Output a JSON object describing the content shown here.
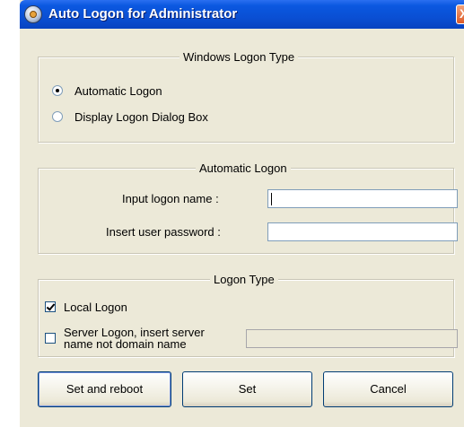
{
  "window": {
    "title": "Auto Logon for Administrator",
    "close_glyph": "X"
  },
  "windows_logon_type": {
    "legend": "Windows Logon Type",
    "options": [
      {
        "label": "Automatic Logon",
        "selected": true
      },
      {
        "label": "Display Logon Dialog Box",
        "selected": false
      }
    ]
  },
  "automatic_logon": {
    "legend": "Automatic Logon",
    "name_label": "Input logon name :",
    "name_value": "",
    "password_label": "Insert user password :",
    "password_value": ""
  },
  "logon_type": {
    "legend": "Logon Type",
    "local_label": "Local Logon",
    "local_checked": true,
    "server_label_line1": "Server Logon, insert server",
    "server_label_line2": "name not domain name",
    "server_checked": false,
    "server_value": ""
  },
  "buttons": {
    "set_and_reboot": "Set and reboot",
    "set": "Set",
    "cancel": "Cancel"
  },
  "icons": {
    "app": "gear-icon",
    "close": "close-icon"
  }
}
